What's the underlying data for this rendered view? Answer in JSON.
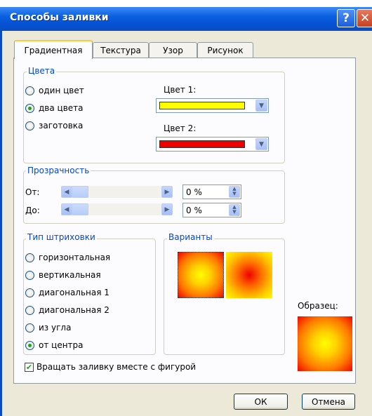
{
  "window": {
    "title": "Способы заливки",
    "help_icon": "question-icon",
    "close_icon": "close-icon"
  },
  "tabs": [
    {
      "label": "Градиентная",
      "active": true
    },
    {
      "label": "Текстура",
      "active": false
    },
    {
      "label": "Узор",
      "active": false
    },
    {
      "label": "Рисунок",
      "active": false
    }
  ],
  "colors_group": {
    "legend": "Цвета",
    "options": [
      {
        "label": "один цвет",
        "selected": false
      },
      {
        "label": "два цвета",
        "selected": true
      },
      {
        "label": "заготовка",
        "selected": false
      }
    ],
    "color1_label": "Цвет 1:",
    "color1_value": "#ffff00",
    "color2_label": "Цвет 2:",
    "color2_value": "#ee0000"
  },
  "transparency_group": {
    "legend": "Прозрачность",
    "from_label": "От:",
    "from_value": "0 %",
    "to_label": "До:",
    "to_value": "0 %"
  },
  "shading_group": {
    "legend": "Тип штриховки",
    "options": [
      {
        "label": "горизонтальная",
        "selected": false
      },
      {
        "label": "вертикальная",
        "selected": false
      },
      {
        "label": "диагональная 1",
        "selected": false
      },
      {
        "label": "диагональная 2",
        "selected": false
      },
      {
        "label": "из угла",
        "selected": false
      },
      {
        "label": "от центра",
        "selected": true
      }
    ]
  },
  "variants": {
    "legend": "Варианты",
    "selected_index": 0
  },
  "sample": {
    "label": "Образец:"
  },
  "rotate_checkbox": {
    "label": "Вращать заливку вместе с фигурой",
    "checked": true
  },
  "buttons": {
    "ok": "ОК",
    "cancel": "Отмена"
  }
}
